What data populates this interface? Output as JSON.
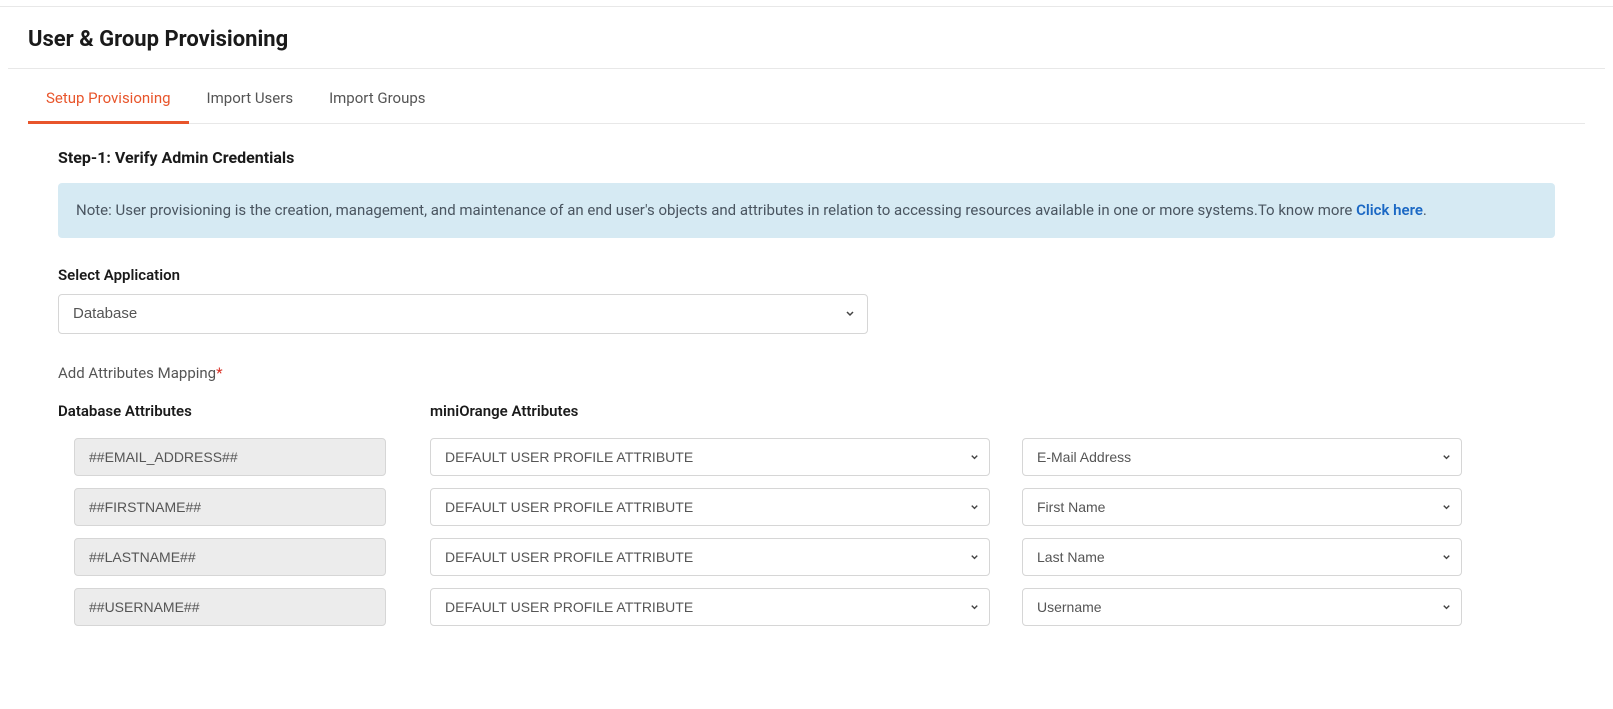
{
  "page": {
    "title": "User & Group Provisioning"
  },
  "tabs": {
    "setup": "Setup Provisioning",
    "import_users": "Import Users",
    "import_groups": "Import Groups"
  },
  "step": {
    "heading": "Step-1: Verify Admin Credentials"
  },
  "note": {
    "prefix": "Note: User provisioning is the creation, management, and maintenance of an end user's objects and attributes in relation to accessing resources available in one or more systems.To know more ",
    "link": "Click here",
    "suffix": "."
  },
  "select_app": {
    "label": "Select Application",
    "value": "Database"
  },
  "mapping": {
    "label": "Add Attributes Mapping",
    "col_db": "Database Attributes",
    "col_mo": "miniOrange Attributes",
    "rows": [
      {
        "db": "##EMAIL_ADDRESS##",
        "type": "DEFAULT USER PROFILE ATTRIBUTE",
        "attr": "E-Mail Address"
      },
      {
        "db": "##FIRSTNAME##",
        "type": "DEFAULT USER PROFILE ATTRIBUTE",
        "attr": "First Name"
      },
      {
        "db": "##LASTNAME##",
        "type": "DEFAULT USER PROFILE ATTRIBUTE",
        "attr": "Last Name"
      },
      {
        "db": "##USERNAME##",
        "type": "DEFAULT USER PROFILE ATTRIBUTE",
        "attr": "Username"
      }
    ]
  }
}
